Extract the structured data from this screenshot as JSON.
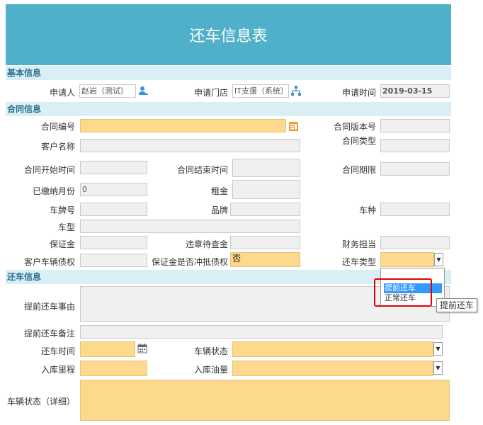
{
  "title": "还车信息表",
  "sections": {
    "basic": "基本信息",
    "contract": "合同信息",
    "return": "还车信息"
  },
  "basic": {
    "applicant_label": "申请人",
    "applicant_value": "赵岩（测试）",
    "store_label": "申请门店",
    "store_value": "IT支援（系统）",
    "time_label": "申请时间",
    "time_value": "2019-03-15"
  },
  "contract": {
    "number_label": "合同编号",
    "version_label": "合同版本号",
    "customer_label": "客户名称",
    "type_label": "合同类型",
    "start_label": "合同开始时间",
    "end_label": "合同结束时间",
    "period_label": "合同期限",
    "paid_months_label": "已缴纳月份",
    "paid_months_value": "0",
    "rent_label": "租金",
    "plate_label": "车牌号",
    "brand_label": "品牌",
    "category_label": "车种",
    "model_label": "车型",
    "deposit_label": "保证金",
    "violation_label": "违章待查金",
    "finance_label": "财务担当",
    "debt_label": "客户车辆债权",
    "offset_label": "保证金是否冲抵债权",
    "offset_value": "否",
    "return_type_label": "还车类型",
    "return_type_options": [
      "提前还车",
      "正常还车"
    ],
    "tooltip": "提前还车"
  },
  "return": {
    "reason_label": "提前还车事由",
    "note_label": "提前还车备注",
    "time_label": "还车时间",
    "status_label": "车辆状态",
    "mileage_label": "入库里程",
    "fuel_label": "入库油量",
    "detail_label": "车辆状态（详细）"
  },
  "colors": {
    "header": "#4fb0c9",
    "section_bg": "#d9eef5",
    "required_field": "#fdd98e",
    "readonly_field": "#f0f0f0",
    "selected_option": "#3399ff",
    "highlight_box": "#e60000"
  }
}
